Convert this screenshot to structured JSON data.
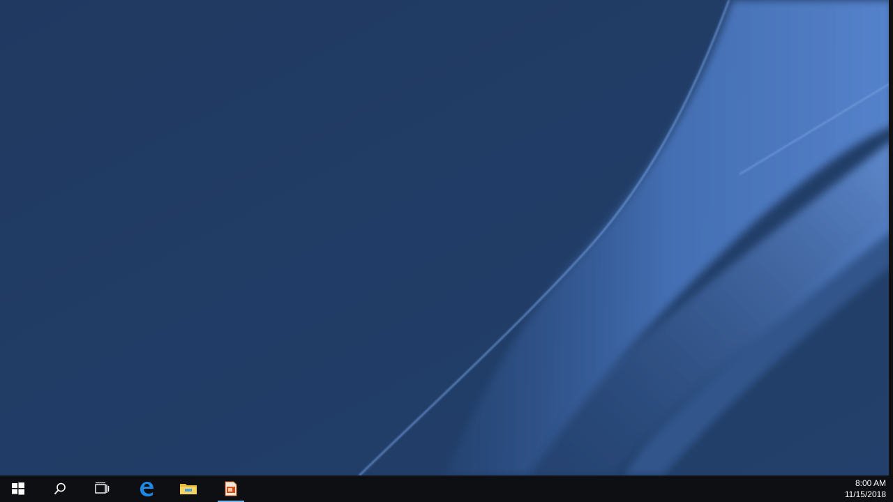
{
  "wallpaper": {
    "base_color": "#213a62",
    "accent_color": "#5a8ad8"
  },
  "taskbar": {
    "background_color": "#0d0f12",
    "items": [
      {
        "name": "start",
        "icon": "windows-logo-icon"
      },
      {
        "name": "search",
        "icon": "search-icon"
      },
      {
        "name": "task-view",
        "icon": "task-view-icon"
      },
      {
        "name": "edge",
        "icon": "edge-browser-icon"
      },
      {
        "name": "file-explorer",
        "icon": "folder-icon"
      },
      {
        "name": "app",
        "icon": "presentation-app-icon",
        "active": true
      }
    ]
  },
  "clock": {
    "time": "8:00 AM",
    "date": "11/15/2018"
  }
}
